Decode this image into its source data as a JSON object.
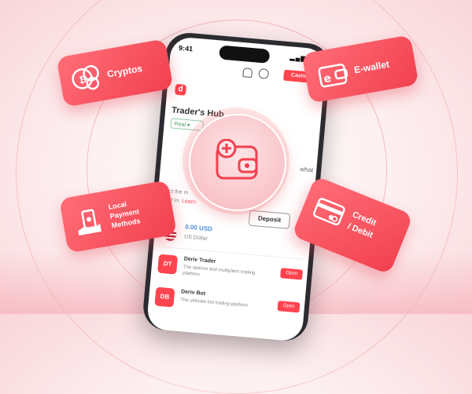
{
  "colors": {
    "brand": "#ff444f",
    "card_gradient_start": "#ff6e78",
    "card_gradient_end": "#f2404e",
    "usd": "#4a90d9",
    "real_chip": "#4a9d6a"
  },
  "phone": {
    "status_time": "9:41",
    "signal": "▂▄▆ ≋",
    "cashier_label": "Cashier",
    "logo_letter": "d",
    "hub_title": "Trader's Hub",
    "account_chip": "Real",
    "chip_chevron": "▾",
    "partial_text": "what",
    "predict_text": "edict the m",
    "predict_text2": "u put in.",
    "learn_more": "Learn",
    "deposit_label": "Deposit",
    "chevron": "⌄",
    "balance": {
      "amount": "0.00 USD",
      "currency": "US Dollar"
    },
    "apps": [
      {
        "tile": "DT",
        "title": "Deriv Trader",
        "desc": "The options and multipliers trading platform.",
        "open": "Open"
      },
      {
        "tile": "DB",
        "title": "Deriv Bot",
        "desc": "The ultimate bot trading platform.",
        "open": "Open"
      }
    ]
  },
  "cards": {
    "cryptos": {
      "label": "Cryptos",
      "icon": "coins-icon"
    },
    "ewallet": {
      "label": "E-wallet",
      "icon": "wallet-icon"
    },
    "local": {
      "line1": "Local",
      "line2": "Payment",
      "line3": "Methods",
      "icon": "hand-cash-icon"
    },
    "credit": {
      "line1": "Credit",
      "line2": "/ Debit",
      "icon": "credit-card-icon"
    }
  },
  "center_icon": "wallet-add-icon"
}
